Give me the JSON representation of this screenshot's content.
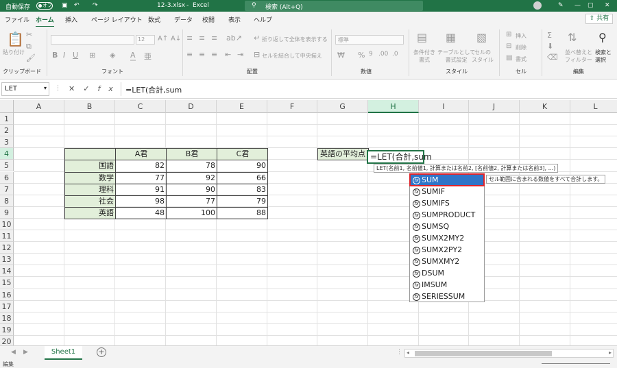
{
  "titlebar": {
    "autosave": "自動保存",
    "autosave_state": "オフ",
    "filename": "12-3.xlsx",
    "app": "Excel",
    "search_placeholder": "検索 (Alt+Q)"
  },
  "tabs": [
    "ファイル",
    "ホーム",
    "挿入",
    "ページ レイアウト",
    "数式",
    "データ",
    "校閲",
    "表示",
    "ヘルプ"
  ],
  "active_tab": "ホーム",
  "share_label": "共有",
  "ribbon": {
    "paste": "貼り付け",
    "clipboard": "クリップボード",
    "font_group": "フォント",
    "font_size": "12",
    "wrap_text": "折り返して全体を表示する",
    "merge_center": "セルを結合して中央揃え",
    "alignment_group": "配置",
    "number_format": "標準",
    "number_group": "数値",
    "conditional": "条件付き\n書式",
    "table_format": "テーブルとして\n書式設定",
    "cell_styles": "セルの\nスタイル",
    "styles_group": "スタイル",
    "insert": "挿入",
    "delete": "削除",
    "format": "書式",
    "cells_group": "セル",
    "sort_filter": "並べ替えと\nフィルター",
    "find_select": "検索と\n選択",
    "editing_group": "編集"
  },
  "formula_bar": {
    "name_box": "LET",
    "formula": "=LET(合計,sum"
  },
  "columns": [
    "A",
    "B",
    "C",
    "D",
    "E",
    "F",
    "G",
    "H",
    "I",
    "J",
    "K",
    "L"
  ],
  "rows": [
    "1",
    "2",
    "3",
    "4",
    "5",
    "6",
    "7",
    "8",
    "9",
    "10",
    "11",
    "12",
    "13",
    "14",
    "15",
    "16",
    "17",
    "18",
    "19",
    "20"
  ],
  "table": {
    "headers": [
      "A君",
      "B君",
      "C君"
    ],
    "rows": [
      {
        "subject": "国語",
        "values": [
          82,
          78,
          90
        ]
      },
      {
        "subject": "数学",
        "values": [
          77,
          92,
          66
        ]
      },
      {
        "subject": "理科",
        "values": [
          91,
          90,
          83
        ]
      },
      {
        "subject": "社会",
        "values": [
          98,
          77,
          79
        ]
      },
      {
        "subject": "英語",
        "values": [
          48,
          100,
          88
        ]
      }
    ]
  },
  "avg_label": "英語の平均点",
  "editing_cell": "=LET(合計,sum",
  "syntax_tooltip": "LET(名前1, 名前値1, 計算または名前2, [名前値2, 計算または名前3], ...)",
  "autocomplete": [
    "SUM",
    "SUMIF",
    "SUMIFS",
    "SUMPRODUCT",
    "SUMSQ",
    "SUMX2MY2",
    "SUMX2PY2",
    "SUMXMY2",
    "DSUM",
    "IMSUM",
    "SERIESSUM"
  ],
  "autocomplete_tip": "セル範囲に含まれる数値をすべて合計します。",
  "sheet_tab": "Sheet1",
  "status": "編集"
}
